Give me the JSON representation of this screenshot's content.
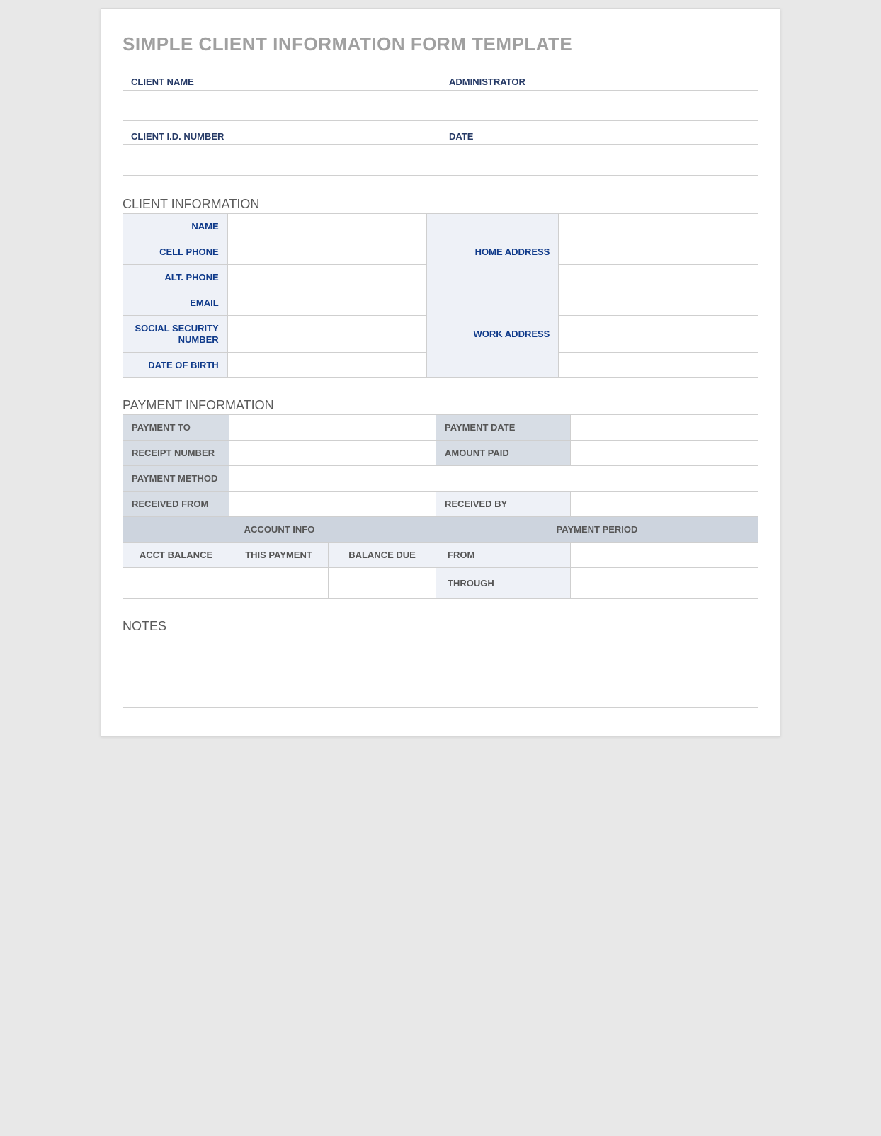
{
  "title": "SIMPLE CLIENT INFORMATION FORM TEMPLATE",
  "topFields": {
    "clientName": {
      "label": "CLIENT NAME",
      "value": ""
    },
    "administrator": {
      "label": "ADMINISTRATOR",
      "value": ""
    },
    "clientId": {
      "label": "CLIENT I.D. NUMBER",
      "value": ""
    },
    "date": {
      "label": "DATE",
      "value": ""
    }
  },
  "clientInfo": {
    "sectionLabel": "CLIENT INFORMATION",
    "rows": {
      "name": {
        "label": "NAME",
        "value": ""
      },
      "cellPhone": {
        "label": "CELL PHONE",
        "value": ""
      },
      "altPhone": {
        "label": "ALT. PHONE",
        "value": ""
      },
      "email": {
        "label": "EMAIL",
        "value": ""
      },
      "ssn": {
        "label": "SOCIAL SECURITY NUMBER",
        "value": ""
      },
      "dob": {
        "label": "DATE OF BIRTH",
        "value": ""
      }
    },
    "homeAddress": {
      "label": "HOME ADDRESS",
      "lines": [
        "",
        "",
        ""
      ]
    },
    "workAddress": {
      "label": "WORK ADDRESS",
      "lines": [
        "",
        "",
        ""
      ]
    }
  },
  "paymentInfo": {
    "sectionLabel": "PAYMENT INFORMATION",
    "paymentTo": {
      "label": "PAYMENT TO",
      "value": ""
    },
    "paymentDate": {
      "label": "PAYMENT DATE",
      "value": ""
    },
    "receiptNumber": {
      "label": "RECEIPT NUMBER",
      "value": ""
    },
    "amountPaid": {
      "label": "AMOUNT PAID",
      "value": ""
    },
    "paymentMethod": {
      "label": "PAYMENT METHOD",
      "value": ""
    },
    "receivedFrom": {
      "label": "RECEIVED FROM",
      "value": ""
    },
    "receivedBy": {
      "label": "RECEIVED BY",
      "value": ""
    },
    "accountInfoHeader": "ACCOUNT INFO",
    "paymentPeriodHeader": "PAYMENT PERIOD",
    "acctBalance": {
      "label": "ACCT BALANCE",
      "value": ""
    },
    "thisPayment": {
      "label": "THIS PAYMENT",
      "value": ""
    },
    "balanceDue": {
      "label": "BALANCE DUE",
      "value": ""
    },
    "periodFrom": {
      "label": "FROM",
      "value": ""
    },
    "periodThrough": {
      "label": "THROUGH",
      "value": ""
    }
  },
  "notes": {
    "sectionLabel": "NOTES",
    "value": ""
  }
}
